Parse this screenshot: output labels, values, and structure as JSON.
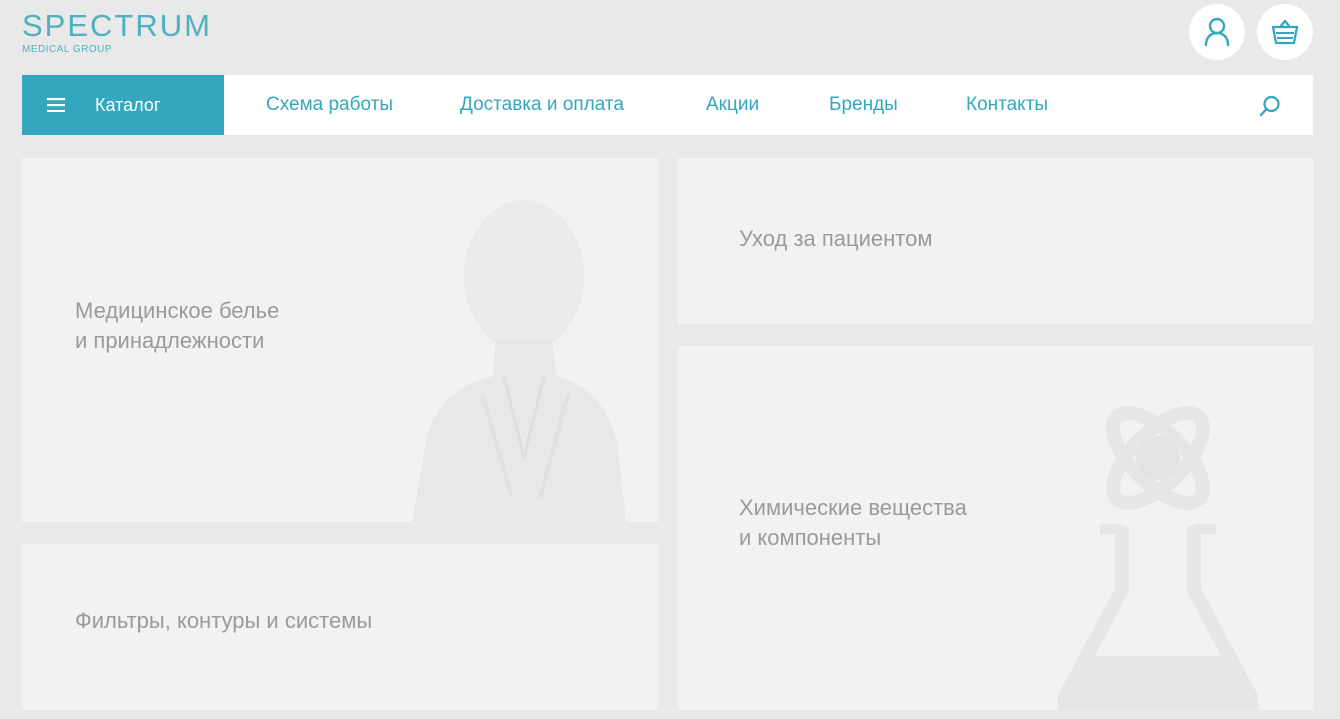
{
  "header": {
    "logo_main": "SPECTRUM",
    "logo_sub": "MEDICAL GROUP",
    "account_icon": "user-icon",
    "cart_icon": "basket-icon"
  },
  "nav": {
    "catalog_label": "Каталог",
    "links": [
      "Схема работы",
      "Доставка и оплата",
      "Акции",
      "Бренды",
      "Контакты"
    ],
    "search_icon": "search-icon"
  },
  "tiles": [
    {
      "label": "Медицинское белье\nи принадлежности",
      "image": "nurse-silhouette"
    },
    {
      "label": "Уход за пациентом"
    },
    {
      "label": "Фильтры, контуры и системы"
    },
    {
      "label": "Химические вещества\nи компоненты",
      "image": "flask-atom-illustration"
    }
  ],
  "colors": {
    "accent": "#33a7bd",
    "page_background": "#e9e9e9",
    "tile_background": "#f2f2f2",
    "tile_text": "#9a9a9a"
  }
}
